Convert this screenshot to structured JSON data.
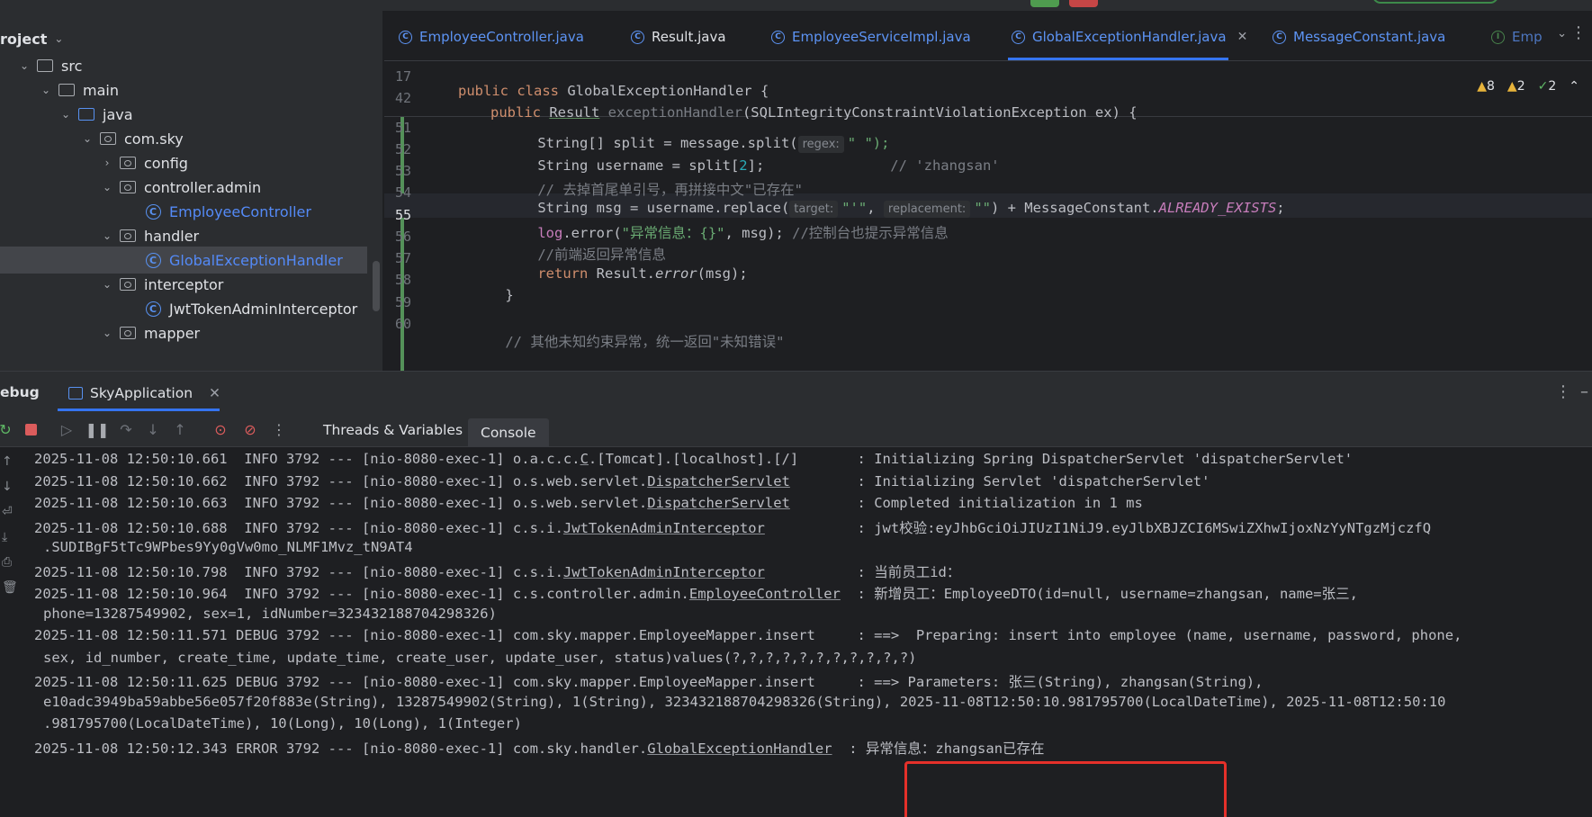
{
  "project": {
    "title": "roject",
    "tree": [
      {
        "label": "src",
        "depth": 1,
        "open": true,
        "icon": "folder-icon"
      },
      {
        "label": "main",
        "depth": 2,
        "open": true,
        "icon": "folder-icon"
      },
      {
        "label": "java",
        "depth": 3,
        "open": true,
        "icon": "source-folder-icon"
      },
      {
        "label": "com.sky",
        "depth": 4,
        "open": true,
        "icon": "package-icon"
      },
      {
        "label": "config",
        "depth": 5,
        "open": false,
        "icon": "package-icon"
      },
      {
        "label": "controller.admin",
        "depth": 5,
        "open": true,
        "icon": "package-icon"
      },
      {
        "label": "EmployeeController",
        "depth": 6,
        "icon": "class-icon"
      },
      {
        "label": "handler",
        "depth": 5,
        "open": true,
        "icon": "package-icon"
      },
      {
        "label": "GlobalExceptionHandler",
        "depth": 6,
        "icon": "class-icon"
      },
      {
        "label": "interceptor",
        "depth": 5,
        "open": true,
        "icon": "package-icon"
      },
      {
        "label": "JwtTokenAdminInterceptor",
        "depth": 6,
        "icon": "class-icon"
      },
      {
        "label": "mapper",
        "depth": 5,
        "open": true,
        "icon": "package-icon"
      }
    ]
  },
  "editor": {
    "tabs": [
      {
        "label": "EmployeeController.java"
      },
      {
        "label": "Result.java"
      },
      {
        "label": "EmployeeServiceImpl.java"
      },
      {
        "label": "GlobalExceptionHandler.java",
        "active": true
      },
      {
        "label": "MessageConstant.java"
      },
      {
        "label": "Emp"
      }
    ],
    "inspections": {
      "warnings": "8",
      "weak": "2",
      "ok": "2"
    },
    "sticky": [
      {
        "num": "17",
        "text": "public class GlobalExceptionHandler {"
      },
      {
        "num": "42",
        "text": "public Result exceptionHandler(SQLIntegrityConstraintViolationException ex) {"
      }
    ],
    "lines": [
      {
        "num": "51",
        "a": "String[] split = message.split(",
        "hint": "regex:",
        "b": "\" \");"
      },
      {
        "num": "52",
        "a": "String username = split[",
        "n": "2",
        "b": "];",
        "c": "// 'zhangsan'"
      },
      {
        "num": "53",
        "c": "// 去掉首尾单引号，再拼接中文\"已存在\""
      },
      {
        "num": "54",
        "a": "String msg = username.replace(",
        "hint1": "target:",
        "s1": "\"'\"",
        "hint2": "replacement:",
        "s2": "\"\"",
        "b": ") + MessageConstant.",
        "f": "ALREADY_EXISTS",
        "e": ";"
      },
      {
        "num": "55",
        "a": "log",
        "b": ".error(",
        "s1": "\"异常信息：{}\"",
        "e": ", msg); ",
        "c": "//控制台也提示异常信息"
      },
      {
        "num": "56",
        "c": "//前端返回异常信息"
      },
      {
        "num": "57",
        "k": "return",
        "a": " Result.",
        "i": "error",
        "b": "(msg);"
      },
      {
        "num": "58",
        "a": "}"
      },
      {
        "num": "59",
        "a": ""
      },
      {
        "num": "60",
        "c": "// 其他未知约束异常，统一返回\"未知错误\""
      }
    ]
  },
  "debug": {
    "title": "ebug",
    "session_tab": "SkyApplication",
    "subtabs": [
      "Threads & Variables",
      "Console"
    ],
    "console": [
      {
        "pre": "2025-11-08 12:50:10.661  INFO 3792 --- [nio-8080-exec-1] o.a.c.c.",
        "u": "C",
        "post": ".[Tomcat].[localhost].[/]       : Initializing Spring DispatcherServlet 'dispatcherServlet'"
      },
      {
        "pre": "2025-11-08 12:50:10.662  INFO 3792 --- [nio-8080-exec-1] o.s.web.servlet.",
        "u": "DispatcherServlet",
        "post": "        : Initializing Servlet 'dispatcherServlet'"
      },
      {
        "pre": "2025-11-08 12:50:10.663  INFO 3792 --- [nio-8080-exec-1] o.s.web.servlet.",
        "u": "DispatcherServlet",
        "post": "        : Completed initialization in 1 ms"
      },
      {
        "pre": "2025-11-08 12:50:10.688  INFO 3792 --- [nio-8080-exec-1] c.s.i.",
        "u": "JwtTokenAdminInterceptor",
        "post": "           : jwt校验:eyJhbGciOiJIUzI1NiJ9.eyJlbXBJZCI6MSwiZXhwIjoxNzYyNTgzMjczfQ"
      },
      {
        "cont": ".SUDIBgF5tTc9WPbes9Yy0gVw0mo_NLMF1Mvz_tN9AT4"
      },
      {
        "pre": "2025-11-08 12:50:10.798  INFO 3792 --- [nio-8080-exec-1] c.s.i.",
        "u": "JwtTokenAdminInterceptor",
        "post": "           : 当前员工id："
      },
      {
        "pre": "2025-11-08 12:50:10.964  INFO 3792 --- [nio-8080-exec-1] c.s.controller.admin.",
        "u": "EmployeeController",
        "post": "  : 新增员工：EmployeeDTO(id=null, username=zhangsan, name=张三,"
      },
      {
        "cont": "phone=13287549902, sex=1, idNumber=323432188704298326)"
      },
      {
        "pre": "2025-11-08 12:50:11.571 DEBUG 3792 --- [nio-8080-exec-1] com.sky.mapper.EmployeeMapper.insert     : ==>  Preparing: insert into employee (name, username, password, phone,"
      },
      {
        "cont": "sex, id_number, create_time, update_time, create_user, update_user, status)values(?,?,?,?,?,?,?,?,?,?,?)"
      },
      {
        "pre": "2025-11-08 12:50:11.625 DEBUG 3792 --- [nio-8080-exec-1] com.sky.mapper.EmployeeMapper.insert     : ==> Parameters: 张三(String), zhangsan(String),"
      },
      {
        "cont": "e10adc3949ba59abbe56e057f20f883e(String), 13287549902(String), 1(String), 323432188704298326(String), 2025-11-08T12:50:10.981795700(LocalDateTime), 2025-11-08T12:50:10"
      },
      {
        "cont": ".981795700(LocalDateTime), 10(Long), 10(Long), 1(Integer)"
      },
      {
        "pre": "2025-11-08 12:50:12.343 ERROR 3792 --- [nio-8080-exec-1] com.sky.handler.",
        "u": "GlobalExceptionHandler",
        "post": "  : 异常信息：zhangsan已存在"
      }
    ]
  }
}
